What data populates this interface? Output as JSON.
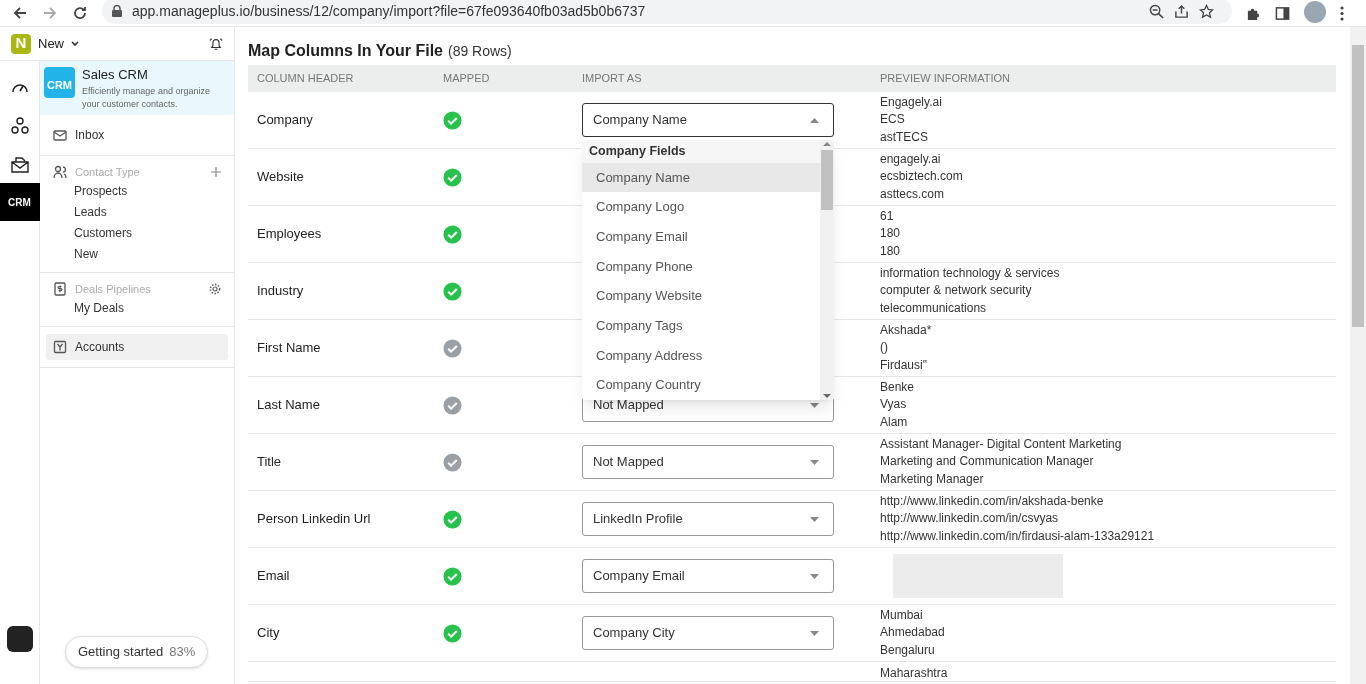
{
  "browser": {
    "url": "app.manageplus.io/business/12/company/import?file=67fe093640fb03ad5b0b6737"
  },
  "workspace": {
    "logo_letter": "N",
    "name": "New"
  },
  "rail": [
    {
      "kind": "gauge",
      "selected": false
    },
    {
      "kind": "network",
      "selected": false
    },
    {
      "kind": "mail",
      "selected": false
    },
    {
      "kind": "crm",
      "label": "CRM",
      "selected": true
    }
  ],
  "app": {
    "logo_text": "CRM",
    "title": "Sales CRM",
    "subtitle": "Efficiently manage and organize your customer contacts."
  },
  "sidebar": [
    {
      "kind": "item",
      "label": "Inbox",
      "selected": false
    },
    {
      "kind": "section",
      "label": "Contact Type",
      "children": [
        {
          "label": "Prospects"
        },
        {
          "label": "Leads"
        },
        {
          "label": "Customers"
        },
        {
          "label": "New"
        }
      ]
    },
    {
      "kind": "section",
      "label": "Deals Pipelines",
      "children": [
        {
          "label": "My Deals"
        }
      ]
    },
    {
      "kind": "item",
      "label": "Accounts",
      "selected": true
    }
  ],
  "getting_started": {
    "label": "Getting started",
    "percent": "83%"
  },
  "main": {
    "title": "Map Columns In Your File",
    "count": "(89 Rows)"
  },
  "table": {
    "columns": [
      "COLUMN HEADER",
      "MAPPED",
      "IMPORT AS",
      "PREVIEW INFORMATION"
    ],
    "rows": [
      {
        "header": "Company",
        "mapped": true,
        "import_as": "Company Name",
        "open": true,
        "preview": [
          "Engagely.ai",
          "ECS",
          "astTECS"
        ]
      },
      {
        "header": "Website",
        "mapped": true,
        "preview": [
          "engagely.ai",
          "ecsbiztech.com",
          "asttecs.com"
        ]
      },
      {
        "header": "Employees",
        "mapped": true,
        "preview": [
          "61",
          "180",
          "180"
        ]
      },
      {
        "header": "Industry",
        "mapped": true,
        "preview": [
          "information technology & services",
          "computer & network security",
          "telecommunications"
        ]
      },
      {
        "header": "First Name",
        "mapped": false,
        "preview": [
          "Akshada*",
          "()",
          "Firdausi\""
        ]
      },
      {
        "header": "Last Name",
        "mapped": false,
        "import_as": "Not Mapped",
        "open": false,
        "preview": [
          "Benke",
          "Vyas",
          "Alam"
        ]
      },
      {
        "header": "Title",
        "mapped": false,
        "import_as": "Not Mapped",
        "open": false,
        "preview": [
          "Assistant Manager- Digital Content Marketing",
          "Marketing and Communication Manager",
          "Marketing Manager"
        ]
      },
      {
        "header": "Person Linkedin Url",
        "mapped": true,
        "import_as": "LinkedIn Profile",
        "open": false,
        "preview": [
          "http://www.linkedin.com/in/akshada-benke",
          "http://www.linkedin.com/in/csvyas",
          "http://www.linkedin.com/in/firdausi-alam-133a29121"
        ]
      },
      {
        "header": "Email",
        "mapped": true,
        "import_as": "Company Email",
        "open": false,
        "redacted": true
      },
      {
        "header": "City",
        "mapped": true,
        "import_as": "Company City",
        "open": false,
        "preview": [
          "Mumbai",
          "Ahmedabad",
          "Bengaluru"
        ]
      },
      {
        "preview": [
          "Maharashtra"
        ]
      }
    ]
  },
  "dropdown": {
    "group": "Company Fields",
    "options": [
      {
        "label": "Company Name",
        "selected": true
      },
      {
        "label": "Company Logo",
        "selected": false
      },
      {
        "label": "Company Email",
        "selected": false
      },
      {
        "label": "Company Phone",
        "selected": false
      },
      {
        "label": "Company Website",
        "selected": false
      },
      {
        "label": "Company Tags",
        "selected": false
      },
      {
        "label": "Company Address",
        "selected": false
      },
      {
        "label": "Company Country",
        "selected": false
      }
    ]
  }
}
